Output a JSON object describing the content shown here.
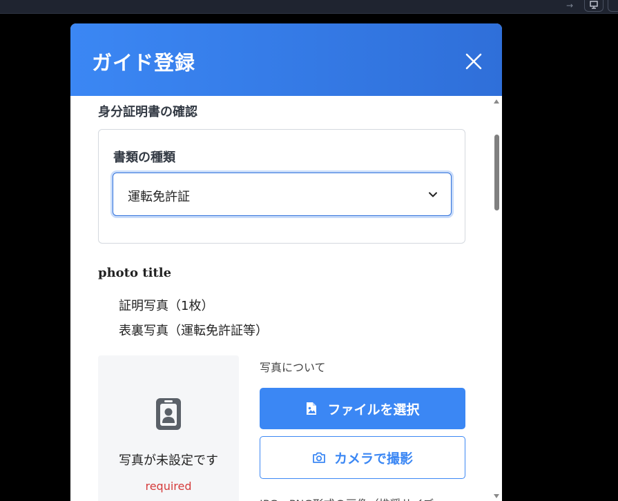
{
  "browser": {
    "forward_icon": "arrow-right-icon",
    "screen_icon": "monitor-icon"
  },
  "modal": {
    "title": "ガイド登録",
    "close_icon": "close-icon"
  },
  "identity": {
    "heading": "身分証明書の確認",
    "doc_type_label": "書類の種類",
    "doc_type_value": "運転免許証"
  },
  "photo": {
    "title": "photo title",
    "requirements": [
      "証明写真（1枚）",
      "表裏写真（運転免許証等）"
    ],
    "preview_icon": "id-badge-icon",
    "preview_text": "写真が未設定です",
    "required_label": "required",
    "about_label": "写真について",
    "file_button_label": "ファイルを選択",
    "file_button_icon": "image-file-icon",
    "camera_button_label": "カメラで撮影",
    "camera_button_icon": "camera-icon",
    "format_note": "JPG、PNG形式の画像（推奨サイズ"
  },
  "colors": {
    "header_start": "#3b87f4",
    "header_end": "#2f6fd9",
    "accent": "#3b87f4",
    "required": "#d53b3b"
  }
}
